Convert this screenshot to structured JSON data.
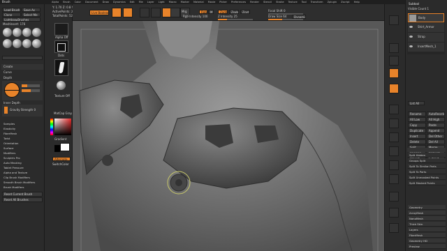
{
  "menubar": {
    "title": "Brush",
    "items": [
      "Alpha",
      "Brush",
      "Color",
      "Document",
      "Draw",
      "Dynamics",
      "Edit",
      "File",
      "Layer",
      "Light",
      "Macro",
      "Marker",
      "Material",
      "Movie",
      "Picker",
      "Preferences",
      "Render",
      "Stencil",
      "Stroke",
      "Texture",
      "Tool",
      "Transform",
      "Zplugin",
      "Zscript",
      "Help"
    ]
  },
  "left_panel": {
    "load_brush": "Load Brush",
    "save_as": "Save As",
    "clone": "Clone",
    "select_me": "Select Me",
    "lightbox_brushes": "Lightbox▸Brushes",
    "mesh_inserts": "MeshInsert: 176",
    "create": "Create",
    "curve": "Curve",
    "depth": "Depth",
    "brush_depth_label": "Gravity Strength 0",
    "inner_depth": "Inner Depth",
    "samples": "Samples",
    "elasticity": "Elasticity",
    "fiber_mesh": "FiberMesh",
    "twist": "Twist",
    "orientation": "Orientation",
    "surface": "Surface",
    "modifiers": "Modifiers",
    "sculptris_pro": "Sculptris Pro",
    "auto_masking": "Auto Masking",
    "tablet_pressure": "Tablet Pressure",
    "alpha_texture": "Alpha and Texture",
    "clip_modifiers": "Clip Brush Modifiers",
    "smooth_modifiers": "Smooth Brush Modifiers",
    "brush_modifiers": "Brush Modifiers",
    "reset_current": "Reset Current Brush",
    "reset_all": "Reset All Brushes"
  },
  "top_toolbar": {
    "info_lines": [
      "Y: 1.70  Z: 0.8  S: 0.7",
      "ActivePoints: 26,416",
      "TotalPoints: 526,186"
    ],
    "live_boolean": "Live Boolean",
    "edit": "Edit",
    "draw": "Draw",
    "move": "Move",
    "scale": "Scale",
    "rotate": "Rotate",
    "mrgb": "Mrgb",
    "rgb": "Rgb",
    "m": "M",
    "zadd": "Zadd",
    "zsub": "Zsub",
    "zcut": "Zcut",
    "rgb_intensity": "Rgb Intensity 100",
    "z_intensity": "Z Intensity 25",
    "focal_shift": "Focal Shift 0",
    "draw_size": "Draw Size 64",
    "dynamic": "Dynamic"
  },
  "mid_column": {
    "alpha_label": "Alpha Off",
    "stroke_label": "Dots",
    "texture_label": "Texture Off",
    "material_label": "MatCap Gray",
    "gradient": "Gradient",
    "switch_color": "SwitchColor",
    "alternate": "Alternate"
  },
  "right_panel": {
    "title": "Subtool",
    "visible_count": "Visible Count 1",
    "list_all": "List All",
    "subtools": [
      "Body",
      "Shirt_Armor",
      "Strap",
      "InsertMesh_1"
    ],
    "items": [
      "Rename",
      "AutoReorder",
      "All Low",
      "All High",
      "Copy",
      "Paste",
      "Duplicate",
      "Append",
      "Insert",
      "Del Other",
      "Delete",
      "Del All",
      "Split",
      "Merge",
      "Boolean",
      "Remesh",
      "Project",
      "Extract"
    ],
    "split_items": [
      "Split Hidden",
      "Groups Split",
      "Split To Similar Parts",
      "Split To Parts",
      "Split Unmasked Points",
      "Split Masked Points"
    ],
    "footer": [
      "Geometry",
      "ArrayMesh",
      "NanoMesh",
      "Thick Skin",
      "Layers",
      "FiberMesh",
      "Geometry HD",
      "Preview"
    ],
    "vertical_tools": [
      "BPR",
      "SPix 3",
      "Scroll",
      "Zoom",
      "Actual",
      "AAHalf",
      "Persp",
      "Floor",
      "Local",
      "Frame",
      "Move",
      "Scale",
      "Rotate",
      "PolyF",
      "Transp",
      "Solo"
    ]
  },
  "colors": {
    "accent": "#e8832a",
    "panel_bg": "#2b2b2b",
    "canvas_bg": "#5a5a5a"
  }
}
